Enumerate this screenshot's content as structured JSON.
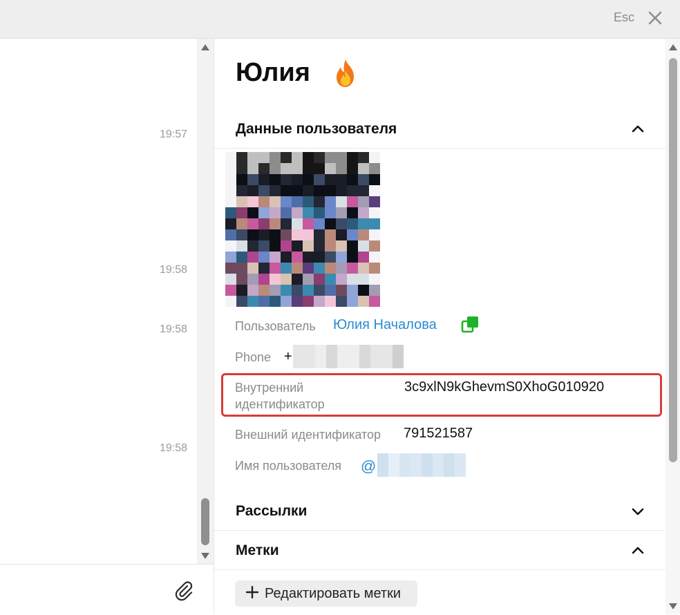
{
  "topbar": {
    "esc_label": "Esc"
  },
  "chat": {
    "times": [
      "19:57",
      "19:58",
      "19:58",
      "19:58"
    ]
  },
  "profile": {
    "name": "Юлия",
    "sections": {
      "user_data": "Данные пользователя",
      "mailings": "Рассылки",
      "tags": "Метки"
    },
    "fields": {
      "user_label": "Пользователь",
      "user_value": "Юлия Началова",
      "phone_label": "Phone",
      "phone_prefix": "+",
      "internal_id_label_line1": "Внутренний",
      "internal_id_label_line2": "идентификатор",
      "internal_id_value": "3c9xlN9kGhevmS0XhoG010920",
      "external_id_label": "Внешний идентификатор",
      "external_id_value": "791521587",
      "username_label": "Имя пользователя",
      "username_prefix": "@"
    },
    "edit_tags_label": "Редактировать метки"
  },
  "colors": {
    "accent_link": "#2a8bd0",
    "highlight": "#d93a3a",
    "copy_icon": "#1db227"
  },
  "icons": [
    "close-icon",
    "paperclip-icon",
    "fire-icon",
    "chevron-up-icon",
    "chevron-down-icon",
    "copy-icon",
    "plus-icon"
  ]
}
